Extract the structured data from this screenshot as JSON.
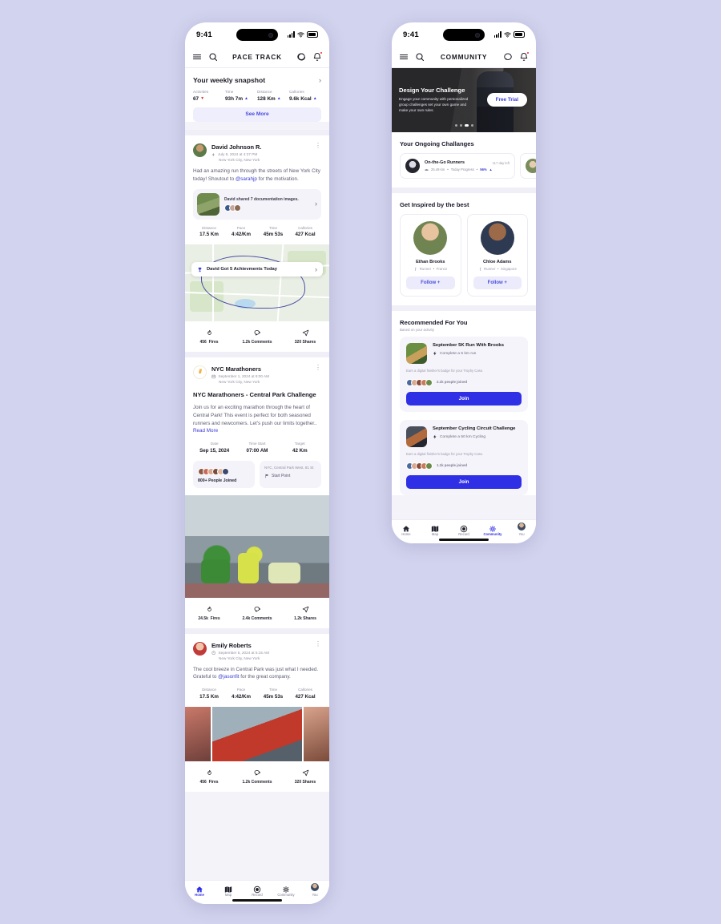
{
  "status_bar": {
    "time": "9:41"
  },
  "phone1": {
    "header": {
      "title": "PACE TRACK",
      "menu_icon": "hamburger-icon",
      "search_icon": "search-icon",
      "chat_icon": "chat-bubble-icon",
      "bell_icon": "bell-icon"
    },
    "weekly_snapshot": {
      "title": "Your weekly snapshot",
      "stats": [
        {
          "label": "Activities",
          "value": "67",
          "trend": "down"
        },
        {
          "label": "Time",
          "value": "93h 7m",
          "trend": "up"
        },
        {
          "label": "Distance",
          "value": "128 Km",
          "trend": "up"
        },
        {
          "label": "Callories",
          "value": "9.6k Kcal",
          "trend": "up"
        }
      ],
      "see_more": "See More"
    },
    "post_david": {
      "name": "David Johnson R.",
      "date": "July 9, 2024 at 4:27 PM",
      "location": "New York City, New York",
      "text_before": "Had an amazing run through the streets of New York City today! Shoutout to ",
      "mention": "@sarahjp",
      "text_after": " for the motivation.",
      "shared_text": "David shared 7 documentation images.",
      "metrics": [
        {
          "label": "Distance",
          "value": "17.5 Km"
        },
        {
          "label": "Pace",
          "value": "4:42/Km"
        },
        {
          "label": "Time",
          "value": "45m 53s"
        },
        {
          "label": "Callories",
          "value": "427 Kcal"
        }
      ],
      "achievement": "David Got 5 Achievments Today",
      "engagement": [
        {
          "count": "456",
          "label": "Fires",
          "icon": "fire-icon"
        },
        {
          "count": "1.2k",
          "label": "Comments",
          "icon": "comment-icon"
        },
        {
          "count": "320",
          "label": "Shares",
          "icon": "share-icon"
        }
      ]
    },
    "post_nyc": {
      "name": "NYC Marathoners",
      "date": "September 1, 2024 at 8:00 AM",
      "location": "New York City, New York",
      "title": "NYC Marathoners - Central Park Challenge",
      "body": "Join us for an exciting marathon through the heart of Central Park! This event is perfect for both seasoned runners and newcomers. Let's push our limits together..",
      "read_more": "Read More",
      "metrics": [
        {
          "label": "Date",
          "value": "Sep 15, 2024"
        },
        {
          "label": "Time Start",
          "value": "07:00 AM"
        },
        {
          "label": "Target",
          "value": "42 Km"
        }
      ],
      "joined": "800+ People Joined",
      "address": "NYC, Central Park West, 81 St",
      "start_point": "Start Point",
      "engagement": [
        {
          "count": "24.5k",
          "label": "Fires",
          "icon": "fire-icon"
        },
        {
          "count": "2.4k",
          "label": "Comments",
          "icon": "comment-icon"
        },
        {
          "count": "1.2k",
          "label": "Shares",
          "icon": "share-icon"
        }
      ]
    },
    "post_emily": {
      "name": "Emily Roberts",
      "date": "September 5, 2024 at 6:15 AM",
      "location": "New York City, New York",
      "text_before": "The cool breeze in Central Park was just what I needed. Grateful to ",
      "mention": "@jasonfit",
      "text_after": " for the great company.",
      "metrics": [
        {
          "label": "Distance",
          "value": "17.5 Km"
        },
        {
          "label": "Pace",
          "value": "4:42/Km"
        },
        {
          "label": "Time",
          "value": "45m 53s"
        },
        {
          "label": "Callories",
          "value": "427 Kcal"
        }
      ],
      "engagement": [
        {
          "count": "456",
          "label": "Fires",
          "icon": "fire-icon"
        },
        {
          "count": "1.2k",
          "label": "Comments",
          "icon": "comment-icon"
        },
        {
          "count": "320",
          "label": "Shares",
          "icon": "share-icon"
        }
      ]
    },
    "tabs": [
      {
        "label": "Home",
        "icon": "home-icon",
        "active": true
      },
      {
        "label": "Map",
        "icon": "map-icon",
        "active": false
      },
      {
        "label": "Record",
        "icon": "record-icon",
        "active": false
      },
      {
        "label": "Community",
        "icon": "community-icon",
        "active": false
      },
      {
        "label": "You",
        "icon": "profile-avatar-icon",
        "active": false
      }
    ]
  },
  "phone2": {
    "header": {
      "title": "COMMUNITY",
      "menu_icon": "hamburger-icon",
      "search_icon": "search-icon",
      "chat_icon": "chat-bubble-icon",
      "bell_icon": "bell-icon"
    },
    "banner": {
      "title": "Design Your Challenge",
      "subtitle": "Engage your community with personalized group challenges set your own game and make your own rules.",
      "button": "Free Trial"
    },
    "ongoing": {
      "title": "Your Ongoing Challanges",
      "cards": [
        {
          "name": "On-the-Go Runners",
          "days_left": "117 day left",
          "distance": "25.49 km",
          "progress_label": "Today Progress",
          "progress": "56%"
        }
      ]
    },
    "inspired": {
      "title": "Get Inspired by the best",
      "people": [
        {
          "name": "Ethan Brooks",
          "role": "Runner",
          "country": "France",
          "button": "Follow +"
        },
        {
          "name": "Chloe Adams",
          "role": "Runner",
          "country": "Singapore",
          "button": "Follow +"
        }
      ]
    },
    "recommended": {
      "title": "Recommended For You",
      "subtitle": "Based on your activity",
      "cards": [
        {
          "title": "September 5K Run With Brooks",
          "goal": "Complete a 5 km run",
          "badge": "Earn a digital finisher's badge for your Trophy Case.",
          "joined": "2.1k people joined",
          "button": "Join"
        },
        {
          "title": "September Cycling Circuit Challenge",
          "goal": "Complete a 50 km Cycling",
          "badge": "Earn a digital finisher's badge for your Trophy Case.",
          "joined": "1.1k people joined",
          "button": "Join"
        }
      ]
    },
    "tabs": [
      {
        "label": "Home",
        "icon": "home-icon",
        "active": false
      },
      {
        "label": "Map",
        "icon": "map-icon",
        "active": false
      },
      {
        "label": "Record",
        "icon": "record-icon",
        "active": false
      },
      {
        "label": "Community",
        "icon": "community-icon",
        "active": true
      },
      {
        "label": "You",
        "icon": "profile-avatar-icon",
        "active": false
      }
    ]
  },
  "colors": {
    "accent": "#2f2fe6",
    "accent_soft": "#ebebfb",
    "background": "#d2d3ee",
    "danger": "#e0322a"
  }
}
